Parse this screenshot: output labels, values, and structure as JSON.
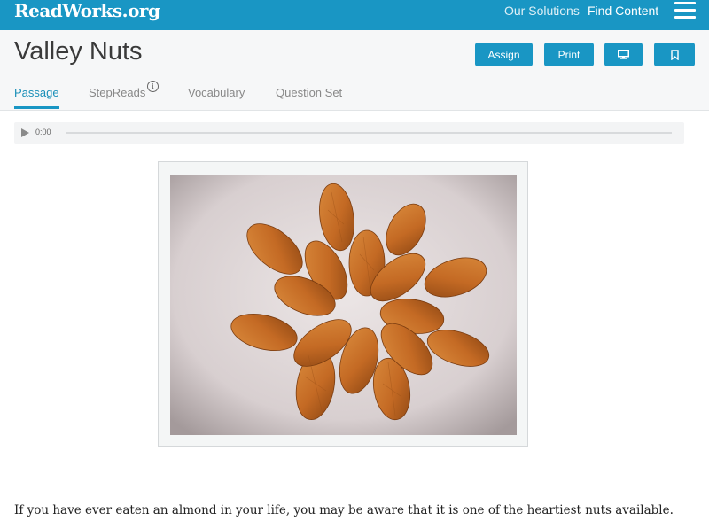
{
  "header": {
    "logo": "ReadWorks.org",
    "nav": {
      "solutions": "Our Solutions",
      "find": "Find Content"
    }
  },
  "page": {
    "title": "Valley Nuts",
    "buttons": {
      "assign": "Assign",
      "print": "Print"
    },
    "tabs": {
      "passage": "Passage",
      "stepreads": "StepReads",
      "vocabulary": "Vocabulary",
      "question_set": "Question Set"
    }
  },
  "audio": {
    "time": "0:00"
  },
  "passage": {
    "first_line": "If you have ever eaten an almond in your life, you may be aware that it is one of the heartiest nuts available."
  },
  "colors": {
    "brand": "#1996c4",
    "header_bg": "#f6f7f8"
  }
}
